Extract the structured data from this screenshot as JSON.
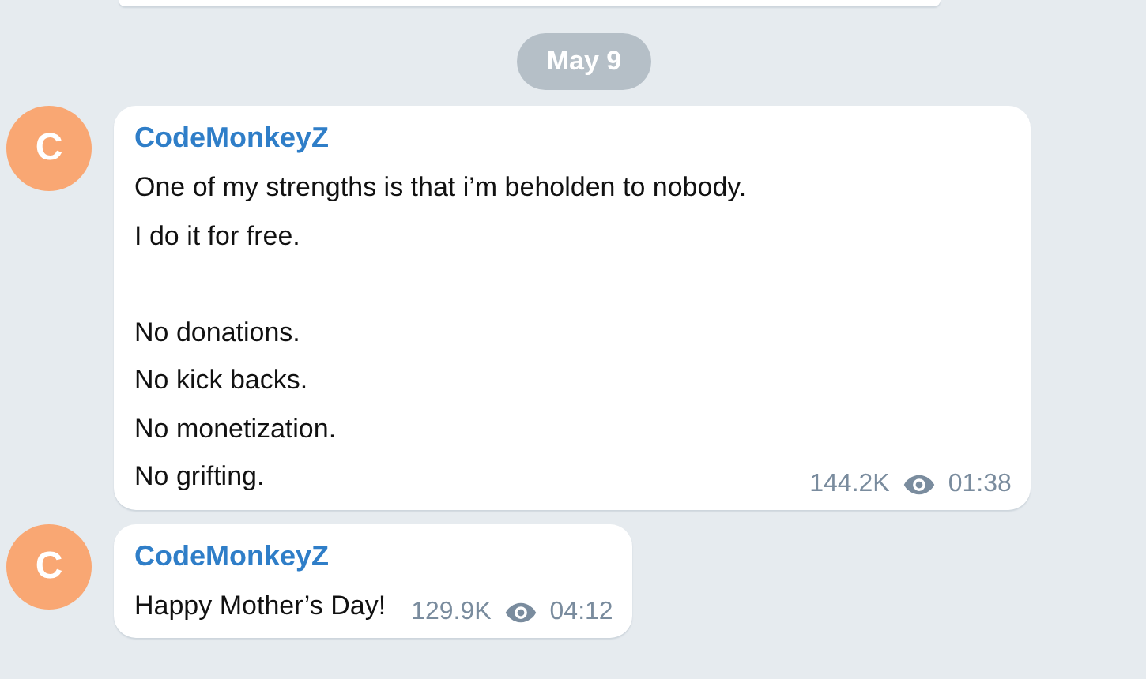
{
  "date_separator": "May 9",
  "messages": [
    {
      "avatar_letter": "C",
      "author": "CodeMonkeyZ",
      "text": "One of my strengths is that i’m beholden to nobody.\nI do it for free.\n\nNo donations.\nNo kick backs.\nNo monetization.\nNo grifting.",
      "views": "144.2K",
      "time": "01:38"
    },
    {
      "avatar_letter": "C",
      "author": "CodeMonkeyZ",
      "text": "Happy Mother’s Day!",
      "views": "129.9K",
      "time": "04:12"
    }
  ]
}
